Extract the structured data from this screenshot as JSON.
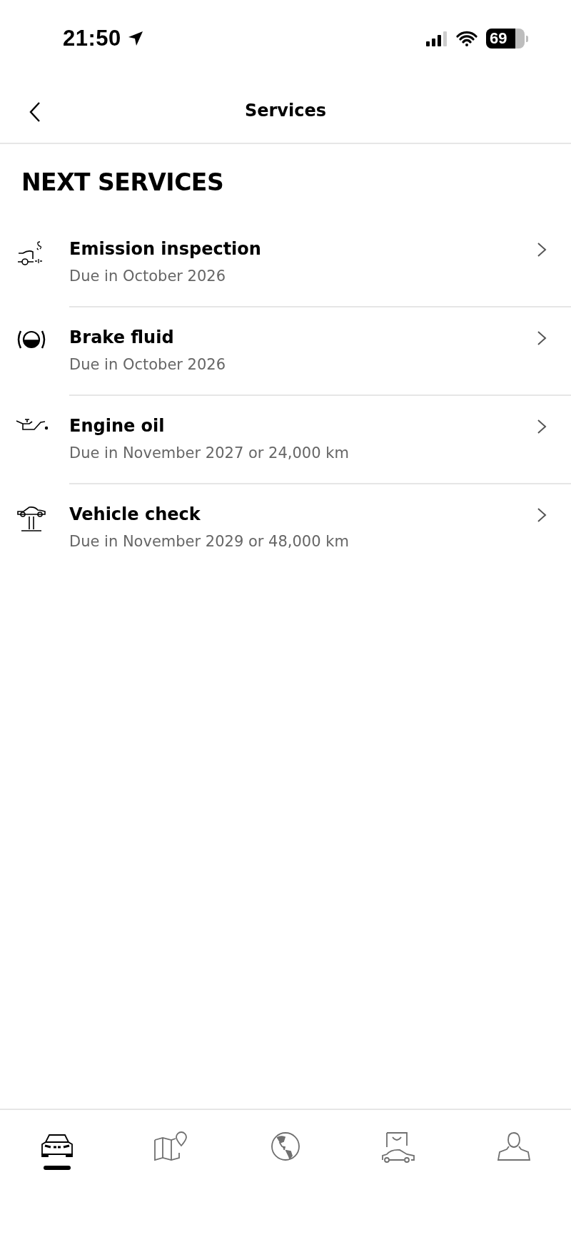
{
  "status_bar": {
    "time": "21:50",
    "battery": "69"
  },
  "header": {
    "title": "Services"
  },
  "section": {
    "title": "NEXT SERVICES"
  },
  "services": [
    {
      "kind": "emission",
      "title": "Emission inspection",
      "due": "Due in October 2026"
    },
    {
      "kind": "brake",
      "title": "Brake fluid",
      "due": "Due in October 2026"
    },
    {
      "kind": "oil",
      "title": "Engine oil",
      "due": "Due in November 2027 or 24,000 km"
    },
    {
      "kind": "lift",
      "title": "Vehicle check",
      "due": "Due in November 2029 or 48,000 km"
    }
  ],
  "tab_bar": {
    "tabs": [
      {
        "kind": "car",
        "selected": true
      },
      {
        "kind": "map",
        "selected": false
      },
      {
        "kind": "globe",
        "selected": false
      },
      {
        "kind": "shop",
        "selected": false
      },
      {
        "kind": "profile",
        "selected": false
      }
    ]
  }
}
